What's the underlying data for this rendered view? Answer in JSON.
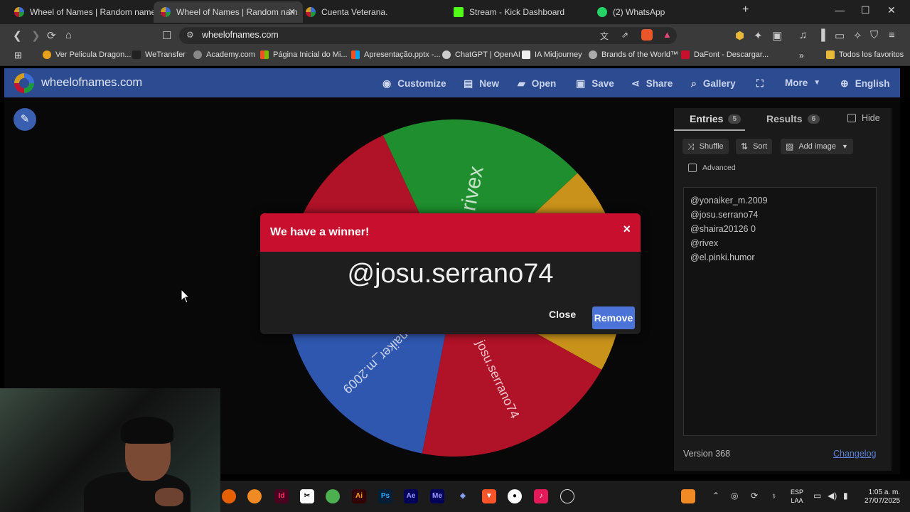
{
  "browser": {
    "tabs": [
      {
        "title": "Wheel of Names | Random name pic",
        "color": "#d84a3a"
      },
      {
        "title": "Wheel of Names | Random nam",
        "color": "#d84a3a",
        "active": true
      },
      {
        "title": "Cuenta Veterana.",
        "color": "#d84a3a"
      },
      {
        "title": "Stream - Kick Dashboard",
        "color": "#53fc18"
      },
      {
        "title": "(2) WhatsApp",
        "color": "#25d366"
      }
    ],
    "url": "wheelofnames.com",
    "bookmarks": [
      "Ver Pelicula Dragon...",
      "WeTransfer",
      "Academy.com",
      "Página Inicial do Mi...",
      "Apresentação.pptx -...",
      "ChatGPT | OpenAI",
      "IA Midjourney",
      "Brands of the World™",
      "DaFont - Descargar...",
      "Todos los favoritos"
    ]
  },
  "site": {
    "name": "wheelofnames.com",
    "menu": [
      "Customize",
      "New",
      "Open",
      "Save",
      "Share",
      "Gallery",
      "More",
      "English"
    ]
  },
  "wheel": {
    "segments": [
      {
        "label": "rivex",
        "color": "#1e8e2e"
      },
      {
        "label": "shaira20126 0",
        "color": "#c9921a"
      },
      {
        "label": "josu.serrano74",
        "color": "#b01228"
      },
      {
        "label": "yonaiker_m.2009",
        "color": "#2f57b0"
      },
      {
        "label": "el.pinki.humor",
        "color": "#b01228"
      }
    ]
  },
  "panel": {
    "tab_entries": "Entries",
    "entries_count": "5",
    "tab_results": "Results",
    "results_count": "6",
    "hide_label": "Hide",
    "shuffle": "Shuffle",
    "sort": "Sort",
    "add_image": "Add image",
    "advanced": "Advanced",
    "entries": [
      "@yonaiker_m.2009",
      "@josu.serrano74",
      "@shaira20126 0",
      "@rivex",
      "@el.pinki.humor"
    ],
    "version": "Version 368",
    "changelog": "Changelog"
  },
  "dialog": {
    "title": "We have a winner!",
    "winner": "@josu.serrano74",
    "close": "Close",
    "remove": "Remove"
  },
  "taskbar": {
    "lang": "ESP",
    "lang2": "LAA",
    "time": "1:05 a. m.",
    "date": "27/07/2025"
  }
}
